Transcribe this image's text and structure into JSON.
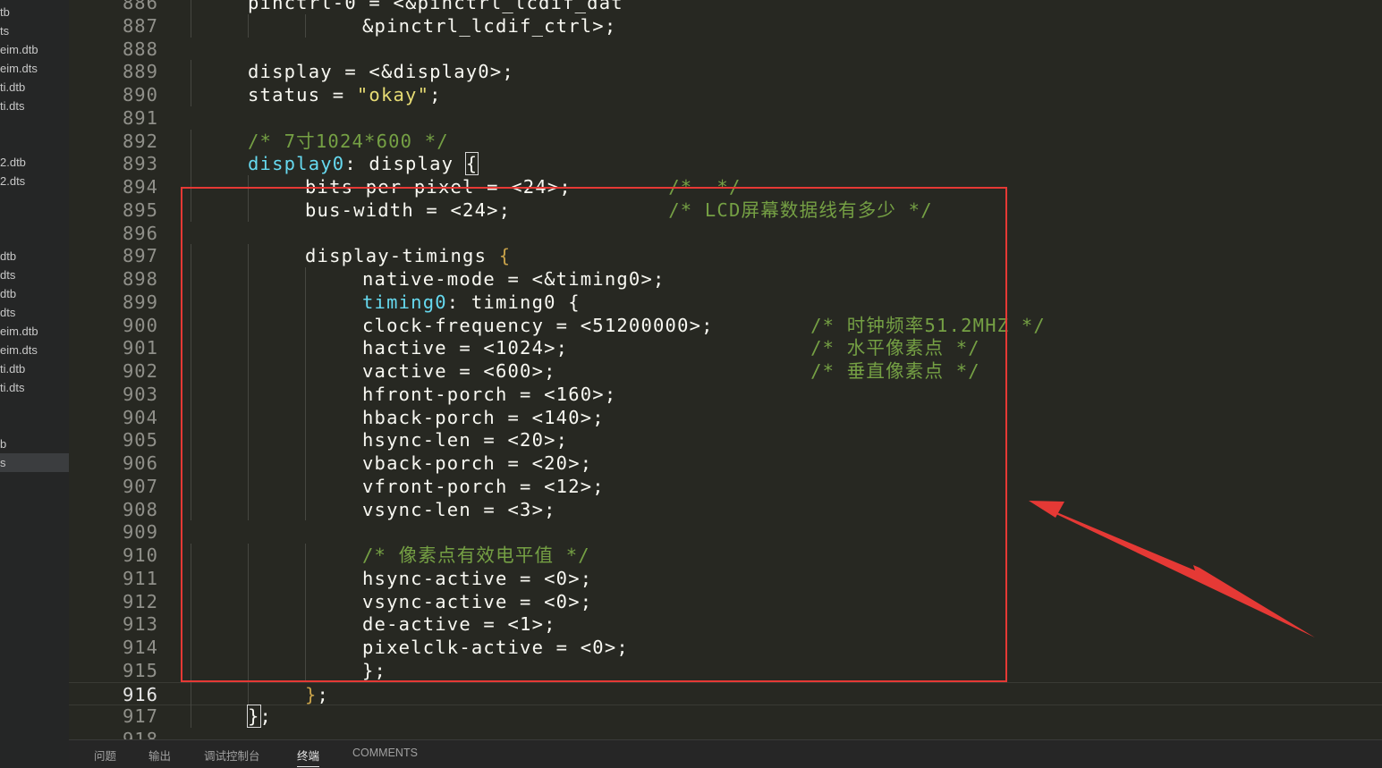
{
  "sidebar": {
    "files": [
      {
        "label": "tb",
        "selected": false
      },
      {
        "label": "ts",
        "selected": false
      },
      {
        "label": "eim.dtb",
        "selected": false
      },
      {
        "label": "eim.dts",
        "selected": false
      },
      {
        "label": "ti.dtb",
        "selected": false
      },
      {
        "label": "ti.dts",
        "selected": false
      },
      {
        "label": "",
        "selected": false
      },
      {
        "label": "",
        "selected": false
      },
      {
        "label": "2.dtb",
        "selected": false
      },
      {
        "label": "2.dts",
        "selected": false
      },
      {
        "label": "",
        "selected": false
      },
      {
        "label": "",
        "selected": false
      },
      {
        "label": "",
        "selected": false
      },
      {
        "label": "dtb",
        "selected": false
      },
      {
        "label": "dts",
        "selected": false
      },
      {
        "label": "dtb",
        "selected": false
      },
      {
        "label": "dts",
        "selected": false
      },
      {
        "label": "eim.dtb",
        "selected": false
      },
      {
        "label": "eim.dts",
        "selected": false
      },
      {
        "label": "ti.dtb",
        "selected": false
      },
      {
        "label": "ti.dts",
        "selected": false
      },
      {
        "label": "",
        "selected": false
      },
      {
        "label": "",
        "selected": false
      },
      {
        "label": "b",
        "selected": false
      },
      {
        "label": "s",
        "selected": true
      }
    ]
  },
  "editor": {
    "current_line": "916",
    "lines": [
      {
        "num": "886",
        "indent": 1,
        "tokens": [
          {
            "t": "pinctrl-0 = <&pinctrl_lcdif_dat",
            "c": ""
          }
        ]
      },
      {
        "num": "887",
        "indent": 3,
        "tokens": [
          {
            "t": "&pinctrl_lcdif_ctrl>;",
            "c": ""
          }
        ]
      },
      {
        "num": "888",
        "indent": 0,
        "tokens": []
      },
      {
        "num": "889",
        "indent": 1,
        "tokens": [
          {
            "t": "display = <&display0>;",
            "c": ""
          }
        ]
      },
      {
        "num": "890",
        "indent": 1,
        "tokens": [
          {
            "t": "status = ",
            "c": ""
          },
          {
            "t": "\"okay\"",
            "c": "str"
          },
          {
            "t": ";",
            "c": ""
          }
        ]
      },
      {
        "num": "891",
        "indent": 0,
        "tokens": []
      },
      {
        "num": "892",
        "indent": 1,
        "tokens": [
          {
            "t": "/* 7寸1024*600 */",
            "c": "cmt"
          }
        ]
      },
      {
        "num": "893",
        "indent": 1,
        "tokens": [
          {
            "t": "display0",
            "c": "lbl"
          },
          {
            "t": ": display ",
            "c": ""
          },
          {
            "t": "{",
            "c": "bbox"
          }
        ]
      },
      {
        "num": "894",
        "indent": 2,
        "tokens": [
          {
            "t": "bits-per-pixel = <24>;        ",
            "c": ""
          },
          {
            "t": "/*  */",
            "c": "cmt"
          }
        ]
      },
      {
        "num": "895",
        "indent": 2,
        "tokens": [
          {
            "t": "bus-width = <24>;             ",
            "c": ""
          },
          {
            "t": "/* LCD屏幕数据线有多少 */",
            "c": "cmt"
          }
        ]
      },
      {
        "num": "896",
        "indent": 0,
        "tokens": []
      },
      {
        "num": "897",
        "indent": 2,
        "tokens": [
          {
            "t": "display-timings ",
            "c": ""
          },
          {
            "t": "{",
            "c": "brk"
          }
        ]
      },
      {
        "num": "898",
        "indent": 3,
        "tokens": [
          {
            "t": "native-mode = <&timing0>;",
            "c": ""
          }
        ]
      },
      {
        "num": "899",
        "indent": 3,
        "tokens": [
          {
            "t": "timing0",
            "c": "lbl"
          },
          {
            "t": ": timing0 {",
            "c": ""
          }
        ]
      },
      {
        "num": "900",
        "indent": 3,
        "tokens": [
          {
            "t": "clock-frequency = <51200000>;        ",
            "c": ""
          },
          {
            "t": "/* 时钟频率51.2MHZ */",
            "c": "cmt"
          }
        ]
      },
      {
        "num": "901",
        "indent": 3,
        "tokens": [
          {
            "t": "hactive = <1024>;                    ",
            "c": ""
          },
          {
            "t": "/* 水平像素点 */",
            "c": "cmt"
          }
        ]
      },
      {
        "num": "902",
        "indent": 3,
        "tokens": [
          {
            "t": "vactive = <600>;                     ",
            "c": ""
          },
          {
            "t": "/* 垂直像素点 */",
            "c": "cmt"
          }
        ]
      },
      {
        "num": "903",
        "indent": 3,
        "tokens": [
          {
            "t": "hfront-porch = <160>;",
            "c": ""
          }
        ]
      },
      {
        "num": "904",
        "indent": 3,
        "tokens": [
          {
            "t": "hback-porch = <140>;",
            "c": ""
          }
        ]
      },
      {
        "num": "905",
        "indent": 3,
        "tokens": [
          {
            "t": "hsync-len = <20>;",
            "c": ""
          }
        ]
      },
      {
        "num": "906",
        "indent": 3,
        "tokens": [
          {
            "t": "vback-porch = <20>;",
            "c": ""
          }
        ]
      },
      {
        "num": "907",
        "indent": 3,
        "tokens": [
          {
            "t": "vfront-porch = <12>;",
            "c": ""
          }
        ]
      },
      {
        "num": "908",
        "indent": 3,
        "tokens": [
          {
            "t": "vsync-len = <3>;",
            "c": ""
          }
        ]
      },
      {
        "num": "909",
        "indent": 0,
        "tokens": []
      },
      {
        "num": "910",
        "indent": 3,
        "tokens": [
          {
            "t": "/* 像素点有效电平值 */",
            "c": "cmt"
          }
        ]
      },
      {
        "num": "911",
        "indent": 3,
        "tokens": [
          {
            "t": "hsync-active = <0>;",
            "c": ""
          }
        ]
      },
      {
        "num": "912",
        "indent": 3,
        "tokens": [
          {
            "t": "vsync-active = <0>;",
            "c": ""
          }
        ]
      },
      {
        "num": "913",
        "indent": 3,
        "tokens": [
          {
            "t": "de-active = <1>;",
            "c": ""
          }
        ]
      },
      {
        "num": "914",
        "indent": 3,
        "tokens": [
          {
            "t": "pixelclk-active = <0>;",
            "c": ""
          }
        ]
      },
      {
        "num": "915",
        "indent": 3,
        "tokens": [
          {
            "t": "};",
            "c": ""
          }
        ]
      },
      {
        "num": "916",
        "indent": 2,
        "tokens": [
          {
            "t": "}",
            "c": "brk"
          },
          {
            "t": ";",
            "c": ""
          }
        ]
      },
      {
        "num": "917",
        "indent": 1,
        "tokens": [
          {
            "t": "}",
            "c": "bbox"
          },
          {
            "t": ";",
            "c": ""
          }
        ]
      },
      {
        "num": "918",
        "indent": 0,
        "tokens": []
      }
    ]
  },
  "panel": {
    "tabs": [
      {
        "label": "问题",
        "active": false
      },
      {
        "label": "输出",
        "active": false
      },
      {
        "label": "调试控制台",
        "active": false
      },
      {
        "label": "终端",
        "active": true
      },
      {
        "label": "COMMENTS",
        "active": false
      }
    ]
  },
  "colors": {
    "background": "#272822",
    "highlight_box": "#e53935",
    "arrow": "#e53935"
  }
}
